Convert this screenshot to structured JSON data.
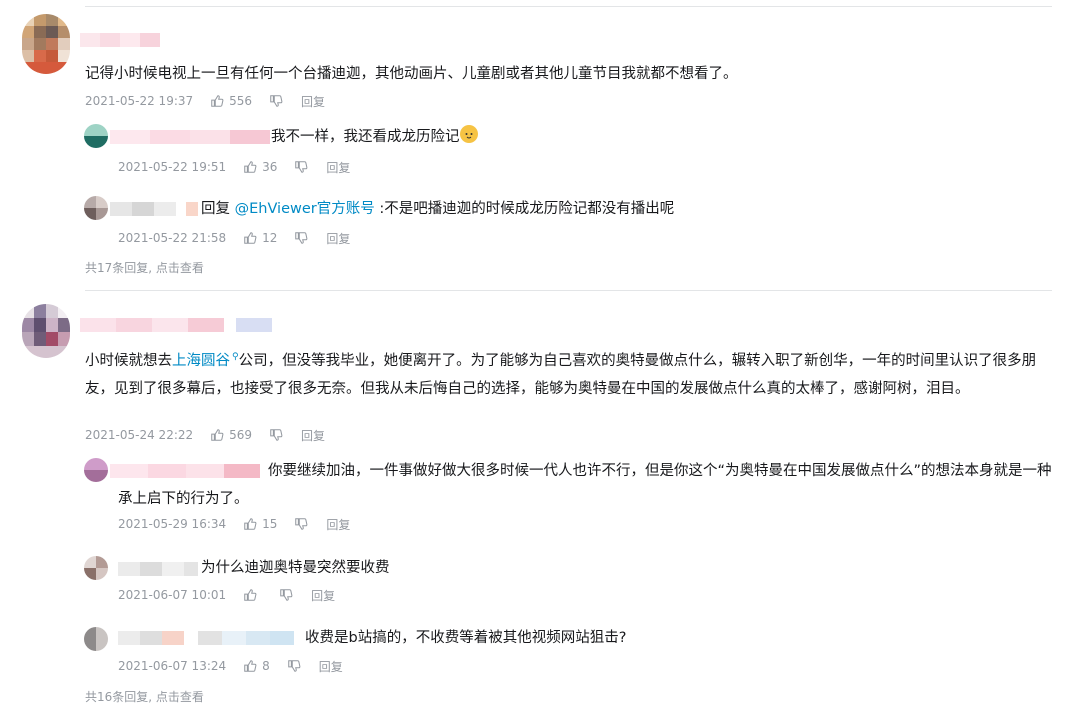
{
  "threads": [
    {
      "comment": {
        "text": "记得小时候电视上一旦有任何一个台播迪迦，其他动画片、儿童剧或者其他儿童节目我就都不想看了。",
        "time": "2021-05-22 19:37",
        "likes": "556",
        "reply_label": "回复"
      },
      "replies": [
        {
          "text": "我不一样，我还看成龙历险记",
          "emoji": "cat-face-emoji",
          "time": "2021-05-22 19:51",
          "likes": "36",
          "reply_label": "回复"
        },
        {
          "prefix": "回复",
          "mention": "@EhViewer官方账号",
          "text": ":不是吧播迪迦的时候成龙历险记都没有播出呢",
          "time": "2021-05-22 21:58",
          "likes": "12",
          "reply_label": "回复"
        }
      ],
      "more_text": "共17条回复, 点击查看"
    },
    {
      "comment": {
        "text_before": "小时候就想去",
        "location_link": "上海圆谷",
        "text_after": "公司，但没等我毕业，她便离开了。为了能够为自己喜欢的奥特曼做点什么，辗转入职了新创华，一年的时间里认识了很多朋友，见到了很多幕后，也接受了很多无奈。但我从未后悔自己的选择，能够为奥特曼在中国的发展做点什么真的太棒了，感谢阿树，泪目。",
        "time": "2021-05-24 22:22",
        "likes": "569",
        "reply_label": "回复"
      },
      "replies": [
        {
          "text": "你要继续加油，一件事做好做大很多时候一代人也许不行，但是你这个“为奥特曼在中国发展做点什么”的想法本身就是一种承上启下的行为了。",
          "time": "2021-05-29 16:34",
          "likes": "15",
          "reply_label": "回复"
        },
        {
          "text": "为什么迪迦奥特曼突然要收费",
          "time": "2021-06-07 10:01",
          "likes": "",
          "reply_label": "回复"
        },
        {
          "text": "收费是b站搞的，不收费等着被其他视频网站狙击?",
          "time": "2021-06-07 13:24",
          "likes": "8",
          "reply_label": "回复"
        }
      ],
      "more_text": "共16条回复, 点击查看"
    }
  ],
  "colors": {
    "text": "#18191c",
    "meta": "#9499a0",
    "link": "#008ac5",
    "divider": "#e3e5e7"
  },
  "icons": {
    "like": "thumbs-up-icon",
    "dislike": "thumbs-down-icon",
    "location": "location-icon"
  }
}
